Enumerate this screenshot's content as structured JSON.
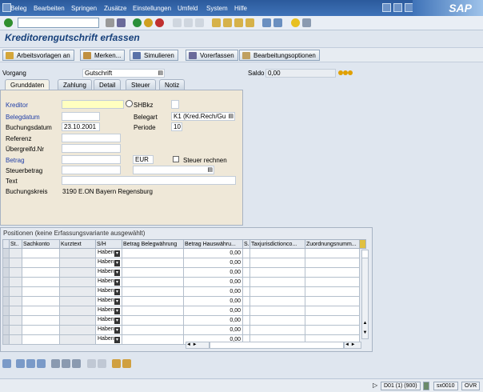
{
  "menu": [
    "Beleg",
    "Bearbeiten",
    "Springen",
    "Zusätze",
    "Einstellungen",
    "Umfeld",
    "System",
    "Hilfe"
  ],
  "brand": "SAP",
  "title": "Kreditorengutschrift erfassen",
  "app_buttons": [
    "Arbeitsvorlagen an",
    "Merken...",
    "Simulieren",
    "Vorerfassen",
    "Bearbeitungsoptionen"
  ],
  "vorgang": {
    "label": "Vorgang",
    "value": "Gutschrift"
  },
  "saldo": {
    "label": "Saldo",
    "value": "0,00"
  },
  "tabs": [
    "Grunddaten",
    "Zahlung",
    "Detail",
    "Steuer",
    "Notiz"
  ],
  "form": {
    "kreditor_label": "Kreditor",
    "shbkz_label": "SHBkz",
    "belegdatum_label": "Belegdatum",
    "belegart_label": "Belegart",
    "belegart_value": "K1 (Kred.Rech/Gu",
    "buchungsdatum_label": "Buchungsdatum",
    "buchungsdatum_value": "23.10.2001",
    "periode_label": "Periode",
    "periode_value": "10",
    "referenz_label": "Referenz",
    "uebergreif_label": "Übergreifd.Nr",
    "betrag_label": "Betrag",
    "waehrung_value": "EUR",
    "steuer_rechnen_label": "Steuer rechnen",
    "steuerbetrag_label": "Steuerbetrag",
    "text_label": "Text",
    "buchungskreis_label": "Buchungskreis",
    "buchungskreis_value": "3190 E.ON Bayern Regensburg"
  },
  "items": {
    "title": "Positionen (keine Erfassungsvariante ausgewählt)",
    "headers": [
      "St..",
      "Sachkonto",
      "Kurztext",
      "S/H",
      "Betrag Belegwährung",
      "Betrag Hauswähru...",
      "S.",
      "Taxjurisdictionco...",
      "Zuordnungsnumm..."
    ],
    "sh_value": "Haben",
    "hw_value": "0,00",
    "row_count": 10
  },
  "status": {
    "system": "D01 (1) (900)",
    "server": "sx0010",
    "mode": "OVR"
  }
}
